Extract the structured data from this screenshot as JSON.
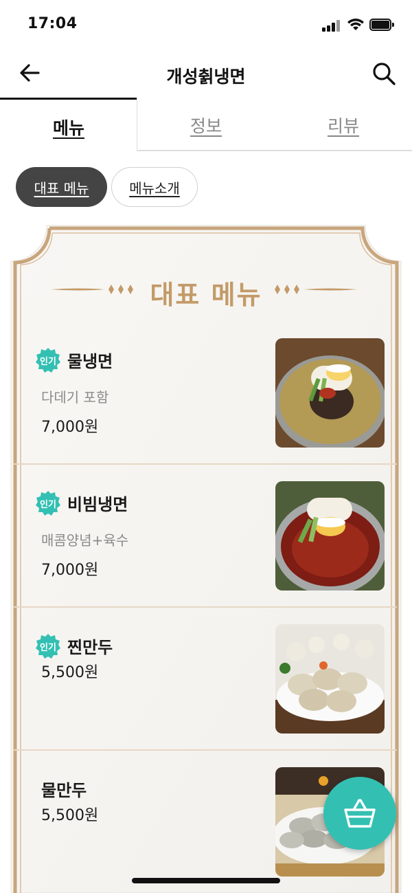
{
  "status_bar": {
    "time": "17:04"
  },
  "header": {
    "title": "개성췱냉면"
  },
  "tabs": [
    {
      "label": "메뉴",
      "active": true
    },
    {
      "label": "정보",
      "active": false
    },
    {
      "label": "리뷰",
      "active": false
    }
  ],
  "chips": [
    {
      "label": "대표 메뉴",
      "selected": true
    },
    {
      "label": "메뉴소개",
      "selected": false
    }
  ],
  "board": {
    "heading": "대표 메뉴",
    "items": [
      {
        "badge": "인기",
        "name": "물냉면",
        "description": "다데기 포함",
        "price": "7,000원",
        "image": "mul-naengmyeon-photo"
      },
      {
        "badge": "인기",
        "name": "비빔냉면",
        "description": "매콤양념+육수",
        "price": "7,000원",
        "image": "bibim-naengmyeon-photo"
      },
      {
        "badge": "인기",
        "name": "찐만두",
        "description": "",
        "price": "5,500원",
        "image": "steamed-dumplings-photo"
      },
      {
        "badge": "",
        "name": "물만두",
        "description": "",
        "price": "5,500원",
        "image": "boiled-dumplings-photo"
      }
    ]
  },
  "fab": {
    "icon": "basket-icon"
  },
  "colors": {
    "accent_teal": "#33c0b3",
    "heading_gold": "#c39a68",
    "board_border": "#c8a57c",
    "chip_dark": "#444444"
  }
}
